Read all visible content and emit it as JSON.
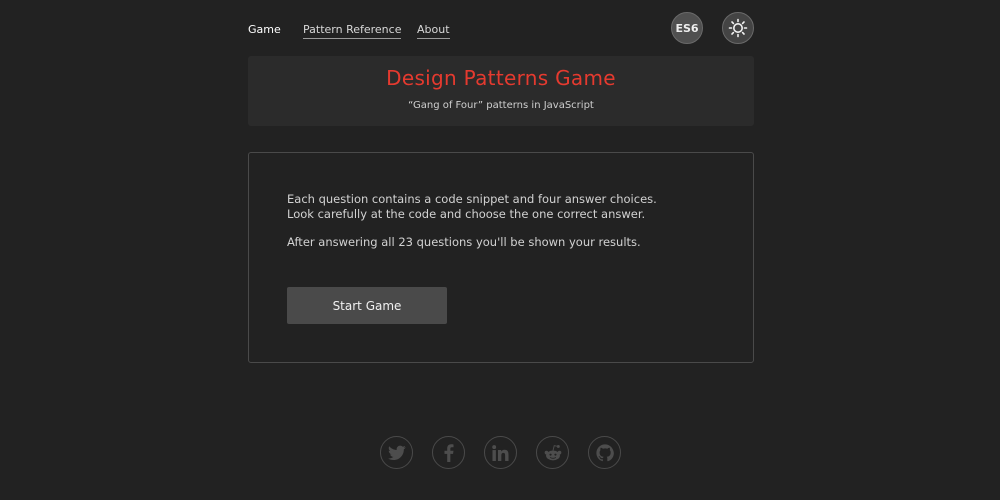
{
  "nav": {
    "links": [
      {
        "label": "Game",
        "active": true
      },
      {
        "label": "Pattern Reference",
        "active": false
      },
      {
        "label": "About",
        "active": false
      }
    ],
    "es6_label": "ES6",
    "theme_icon": "sun-icon"
  },
  "header": {
    "title": "Design Patterns Game",
    "subtitle": "“Gang of Four” patterns in JavaScript"
  },
  "intro": {
    "line1": "Each question contains a code snippet and four answer choices.",
    "line2": "Look carefully at the code and choose the one correct answer.",
    "line3": "After answering all 23 questions you'll be shown your results.",
    "start_label": "Start Game"
  },
  "social": {
    "icons": [
      "twitter-icon",
      "facebook-icon",
      "linkedin-icon",
      "reddit-icon",
      "github-icon"
    ]
  },
  "colors": {
    "background": "#222222",
    "title_accent": "#e53a2f",
    "card": "#2b2b2b",
    "button": "#4a4a4a"
  }
}
